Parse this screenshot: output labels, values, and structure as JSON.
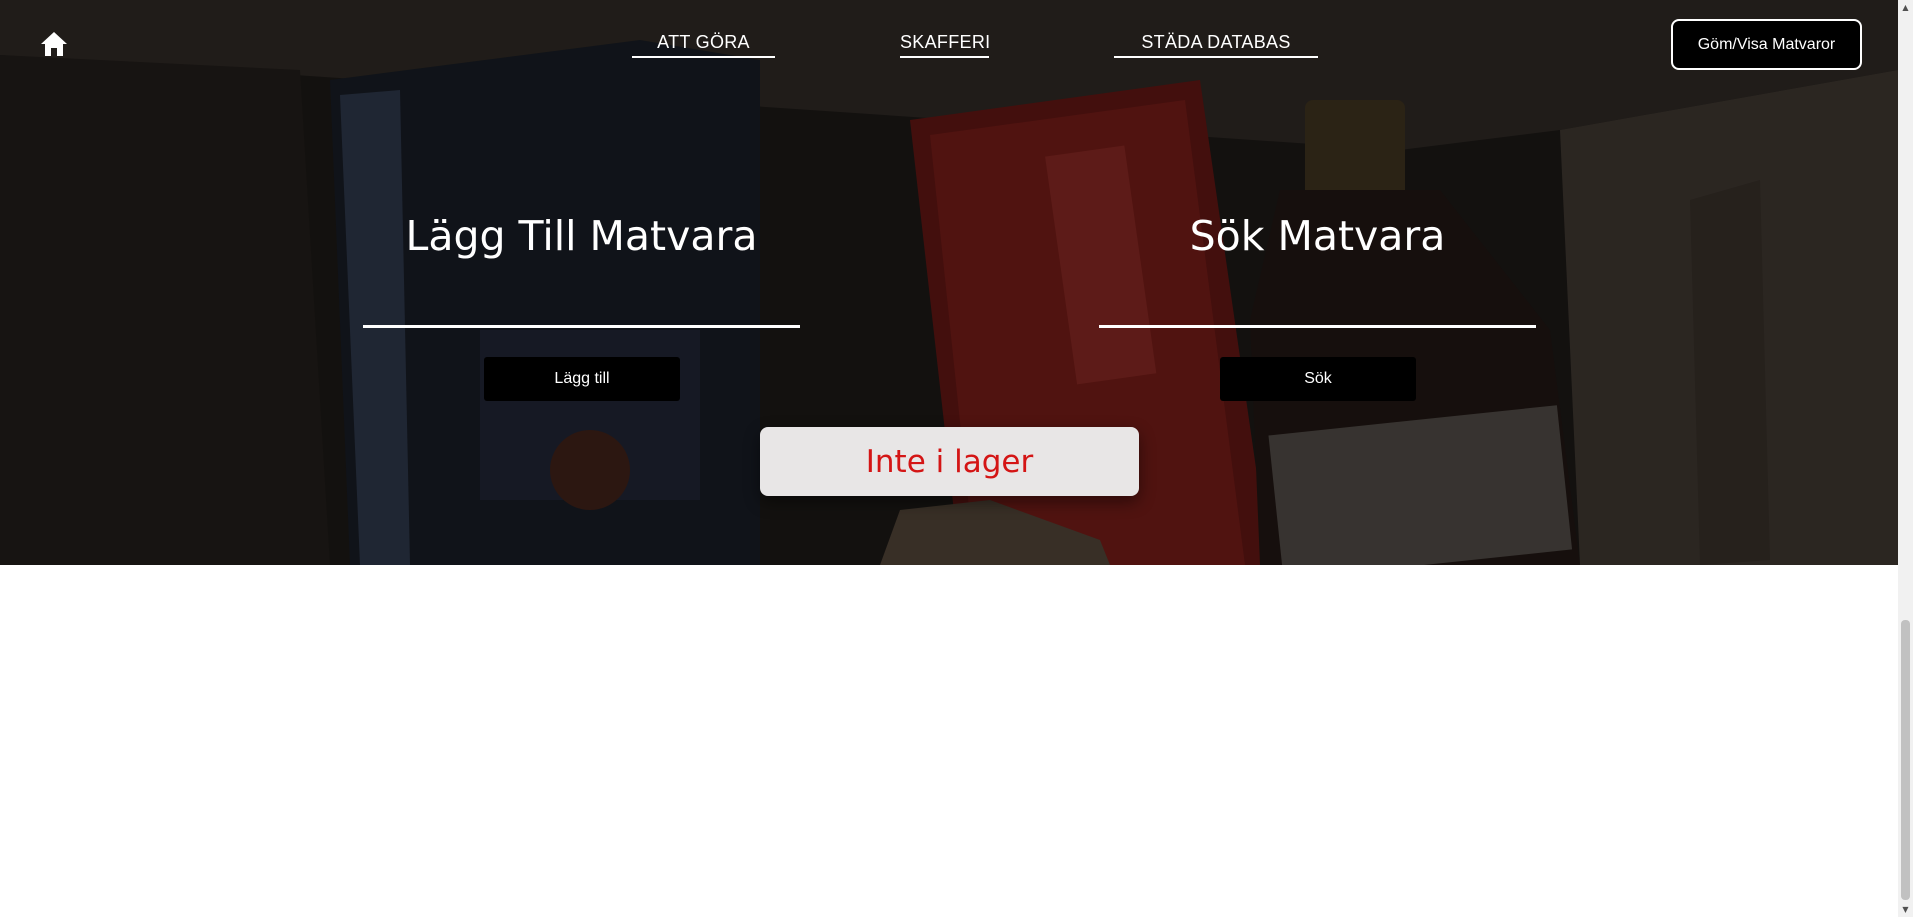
{
  "nav": {
    "home_icon": "home-icon",
    "links": [
      {
        "label": "ATT GÖRA"
      },
      {
        "label": "SKAFFERI"
      },
      {
        "label": "STÄDA DATABAS"
      }
    ],
    "toggle_label": "Göm/Visa Matvaror"
  },
  "add_form": {
    "heading": "Lägg Till Matvara",
    "input_value": "",
    "button_label": "Lägg till"
  },
  "search_form": {
    "heading": "Sök Matvara",
    "input_value": "",
    "button_label": "Sök"
  },
  "stock_button": {
    "label": "Inte i lager",
    "text_color": "#d41515"
  },
  "colors": {
    "hero_text": "#ffffff",
    "button_bg": "#000000",
    "accent_red": "#d41515"
  }
}
